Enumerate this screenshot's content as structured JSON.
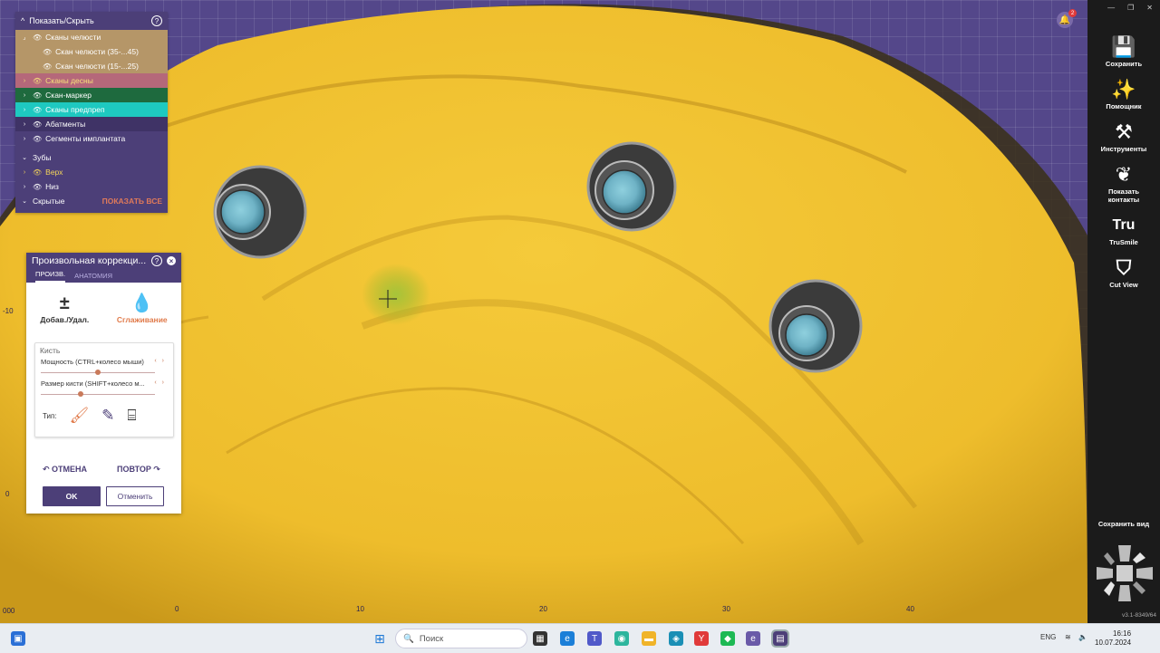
{
  "tree": {
    "title": "Показать/Скрыть",
    "items": [
      {
        "label": "Сканы челюсти"
      },
      {
        "label": "Скан челюсти (35-...45)"
      },
      {
        "label": "Скан челюсти (15-...25)"
      },
      {
        "label": "Сканы десны"
      },
      {
        "label": "Скан-маркер"
      },
      {
        "label": "Сканы предпреп"
      },
      {
        "label": "Абатменты"
      },
      {
        "label": "Сегменты имплантата"
      }
    ],
    "teeth_label": "Зубы",
    "teeth": [
      {
        "label": "Верх"
      },
      {
        "label": "Низ"
      }
    ],
    "hidden_label": "Скрытые",
    "show_all": "ПОКАЗАТЬ ВСЕ"
  },
  "correction": {
    "title": "Произвольная коррекци...",
    "tabs": [
      "ПРОИЗВ.",
      "АНАТОМИЯ"
    ],
    "tool_add": "Добав./Удал.",
    "tool_smooth": "Сглаживание",
    "brush_label": "Кисть",
    "power": {
      "label": "Мощность (CTRL+колесо мыши)",
      "value": 0.5
    },
    "size": {
      "label": "Размер кисти (SHIFT+колесо м...",
      "value": 0.35
    },
    "type_label": "Тип:",
    "undo": "ОТМЕНА",
    "redo": "ПОВТОР",
    "ok": "OK",
    "cancel": "Отменить"
  },
  "sidebar": {
    "items": [
      {
        "label": "Сохранить",
        "icon": "save-icon"
      },
      {
        "label": "Помощник",
        "icon": "wand-icon"
      },
      {
        "label": "Инструменты",
        "icon": "tools-icon"
      },
      {
        "label": "Показать контакты",
        "icon": "contacts-icon"
      },
      {
        "label": "TruSmile",
        "icon": "trusmile-icon"
      },
      {
        "label": "Cut View",
        "icon": "cutview-icon"
      }
    ],
    "save_view": "Сохранить вид",
    "version": "v3.1-8349/64"
  },
  "notifications": {
    "count": "2"
  },
  "rulers": {
    "x_ticks": [
      "0",
      "10",
      "20",
      "30",
      "40"
    ],
    "y_ticks": [
      "-10",
      "0"
    ],
    "corner": "000"
  },
  "taskbar": {
    "search_placeholder": "Поиск",
    "lang": "ENG",
    "time": "16:16",
    "date": "10.07.2024"
  },
  "colors": {
    "scan": "#f2c232",
    "panel": "#4c3f78",
    "accent": "#e07a4a"
  }
}
